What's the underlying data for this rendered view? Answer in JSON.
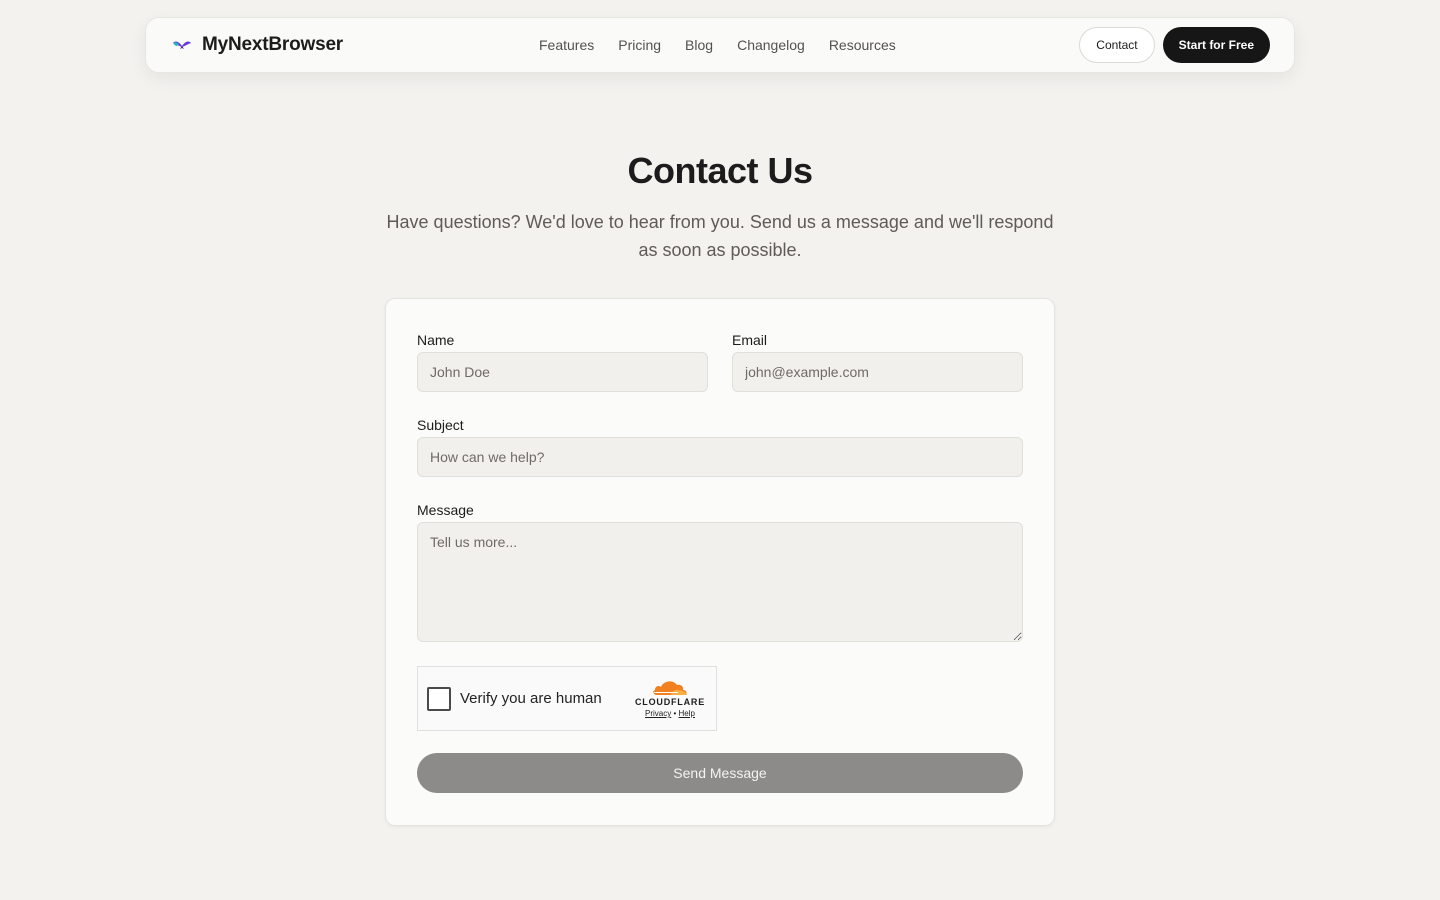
{
  "nav": {
    "brand": "MyNextBrowser",
    "links": [
      "Features",
      "Pricing",
      "Blog",
      "Changelog",
      "Resources"
    ],
    "contact_label": "Contact",
    "start_label": "Start for Free"
  },
  "hero": {
    "title": "Contact Us",
    "subtitle": "Have questions? We'd love to hear from you. Send us a message and we'll respond as soon as possible."
  },
  "form": {
    "name": {
      "label": "Name",
      "placeholder": "John Doe",
      "value": ""
    },
    "email": {
      "label": "Email",
      "placeholder": "john@example.com",
      "value": ""
    },
    "subject": {
      "label": "Subject",
      "placeholder": "How can we help?",
      "value": ""
    },
    "message": {
      "label": "Message",
      "placeholder": "Tell us more...",
      "value": ""
    },
    "captcha": {
      "text": "Verify you are human",
      "brand": "CLOUDFLARE",
      "privacy": "Privacy",
      "separator": "•",
      "help": "Help"
    },
    "submit_label": "Send Message"
  },
  "colors": {
    "background": "#f3f2ef",
    "primary_button": "#161616",
    "disabled_button": "#8c8b89",
    "cloudflare_orange": "#f38020"
  },
  "icons": {
    "brand_logo": "butterfly-logo-icon",
    "cloudflare_logo": "cloudflare-cloud-icon"
  }
}
